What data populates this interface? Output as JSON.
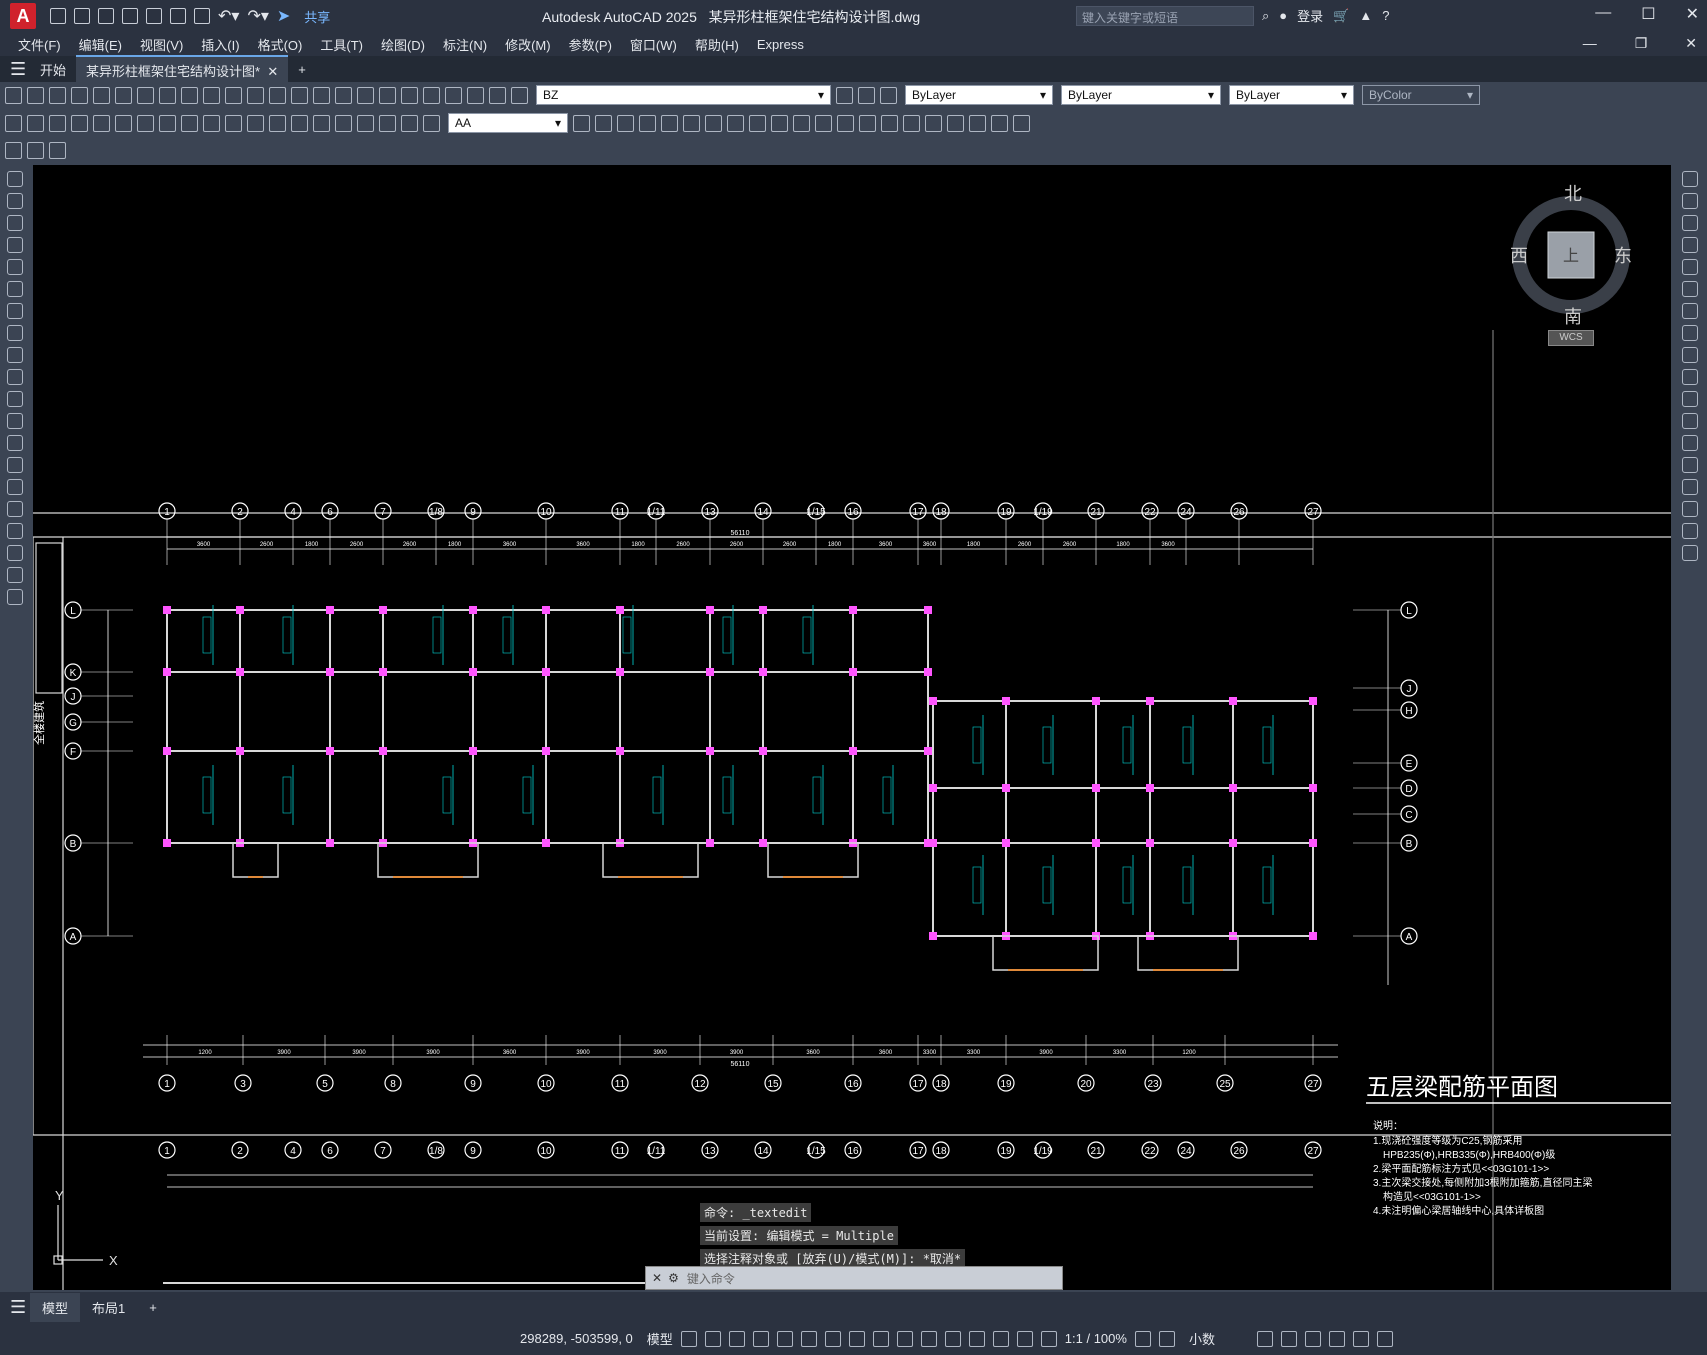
{
  "app": {
    "title": "Autodesk AutoCAD 2025",
    "file": "某异形柱框架住宅结构设计图.dwg",
    "logo": "A"
  },
  "titlebar": {
    "share": "共享",
    "search_placeholder": "键入关键字或短语",
    "login": "登录"
  },
  "menu": [
    "文件(F)",
    "编辑(E)",
    "视图(V)",
    "插入(I)",
    "格式(O)",
    "工具(T)",
    "绘图(D)",
    "标注(N)",
    "修改(M)",
    "参数(P)",
    "窗口(W)",
    "帮助(H)",
    "Express"
  ],
  "tabs": {
    "start": "开始",
    "doc": "某异形柱框架住宅结构设计图*"
  },
  "toolbar": {
    "layer": "BZ",
    "textstyle": "AA",
    "color": "ByLayer",
    "linetype": "ByLayer",
    "lineweight": "ByLayer",
    "plotstyle": "ByColor"
  },
  "viewcube": {
    "north": "北",
    "south": "南",
    "east": "东",
    "west": "西",
    "top": "上",
    "wcs": "WCS"
  },
  "drawing": {
    "title": "五层梁配筋平面图",
    "note_heading": "说明：",
    "notes": [
      "1.现浇砼强度等级为C25,钢筋采用",
      "HPB235(Φ),HRB335(Φ),HRB400(Φ)级",
      "2.梁平面配筋标注方式见<<03G101-1>>",
      "3.主次梁交接处,每侧附加3根附加箍筋,直径同主梁",
      "构造见<<03G101-1>>",
      "4.未注明偏心梁居轴线中心,具体详板图"
    ],
    "top_axes": [
      "1",
      "2",
      "4",
      "6",
      "7",
      "1/8",
      "9",
      "10",
      "11",
      "1/11",
      "13",
      "14",
      "1/15",
      "16",
      "17",
      "18",
      "19",
      "1/19",
      "21",
      "22",
      "24",
      "26",
      "27"
    ],
    "top_dims": [
      "3600",
      "2600",
      "1800",
      "2600",
      "2600",
      "1800",
      "3600",
      "3600",
      "1800",
      "2600",
      "2600",
      "2600",
      "1800",
      "3600",
      "3600",
      "1800",
      "2600",
      "2600",
      "1800",
      "3600"
    ],
    "total_dim": "56110",
    "bottom_axes": [
      "1",
      "3",
      "5",
      "8",
      "9",
      "10",
      "11",
      "12",
      "15",
      "16",
      "17",
      "18",
      "19",
      "20",
      "23",
      "25",
      "27"
    ],
    "bottom_dims": [
      "1200",
      "3900",
      "3900",
      "3900",
      "3600",
      "3900",
      "3900",
      "3900",
      "3600",
      "3600",
      "3300",
      "3300",
      "3900",
      "3300",
      "1200"
    ],
    "left_axes": [
      "L",
      "K",
      "J",
      "G",
      "F",
      "B",
      "A"
    ],
    "right_axes": [
      "L",
      "J",
      "H",
      "E",
      "D",
      "C",
      "B",
      "A"
    ],
    "side_label": "全楼建筑"
  },
  "command": {
    "lines": [
      "命令: _textedit",
      "当前设置: 编辑模式 = Multiple",
      "选择注释对象或 [放弃(U)/模式(M)]: *取消*"
    ],
    "prompt": "键入命令"
  },
  "layouts": {
    "model": "模型",
    "layout1": "布局1"
  },
  "status": {
    "coords": "298289, -503599, 0",
    "model": "模型",
    "scale": "1:1 / 100%",
    "units": "小数"
  }
}
